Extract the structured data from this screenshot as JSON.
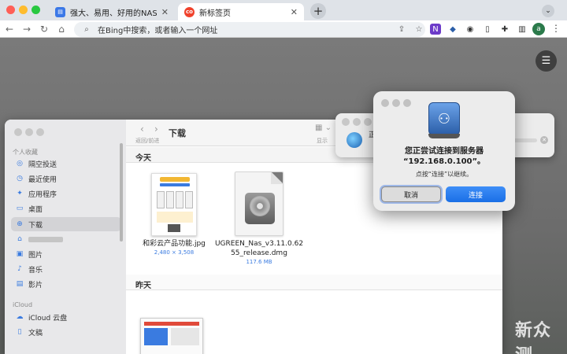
{
  "browser": {
    "tabs": [
      {
        "title": "强大、易用、好用的NAS：绿联",
        "active": false,
        "icon": "doc-icon"
      },
      {
        "title": "新标签页",
        "active": true,
        "icon": "co-logo-icon"
      }
    ],
    "new_tab": "+",
    "tab_menu": "⌄",
    "omnibox": {
      "placeholder": "在Bing中搜索，或者输入一个网址"
    },
    "profile_initial": "a",
    "colors": {
      "close": "#ff5f57",
      "minimize": "#febc2e",
      "maximize": "#28c840",
      "accent": "#1a6fe6"
    }
  },
  "finder": {
    "title": "下载",
    "nav_label": "返回/前进",
    "view_label": "显示",
    "sidebar": {
      "sections": [
        {
          "heading": "个人收藏",
          "items": [
            {
              "label": "隔空投送",
              "icon": "airdrop-icon"
            },
            {
              "label": "最近使用",
              "icon": "clock-icon"
            },
            {
              "label": "应用程序",
              "icon": "apps-icon"
            },
            {
              "label": "桌面",
              "icon": "desktop-icon"
            },
            {
              "label": "下载",
              "icon": "download-icon",
              "selected": true
            },
            {
              "label": "",
              "icon": "home-icon"
            },
            {
              "label": "图片",
              "icon": "photo-icon"
            },
            {
              "label": "音乐",
              "icon": "music-icon"
            },
            {
              "label": "影片",
              "icon": "film-icon"
            }
          ]
        },
        {
          "heading": "iCloud",
          "items": [
            {
              "label": "iCloud 云盘",
              "icon": "cloud-icon"
            },
            {
              "label": "文稿",
              "icon": "doc-icon"
            }
          ]
        }
      ]
    },
    "groups": [
      {
        "heading": "今天",
        "files": [
          {
            "name": "和彩云产品功能.jpg",
            "meta": "2,480 × 3,508"
          },
          {
            "name": "UGREEN_Nas_v3.11.0.62\n55_release.dmg",
            "meta": "117.6 MB"
          }
        ]
      },
      {
        "heading": "昨天",
        "files": []
      }
    ]
  },
  "connecting": {
    "label": "正"
  },
  "dialog": {
    "title": "您正尝试连接到服务器\n“192.168.0.100”。",
    "message": "点按“连接”以继续。",
    "cancel": "取消",
    "connect": "连接"
  },
  "watermark": "新众测"
}
